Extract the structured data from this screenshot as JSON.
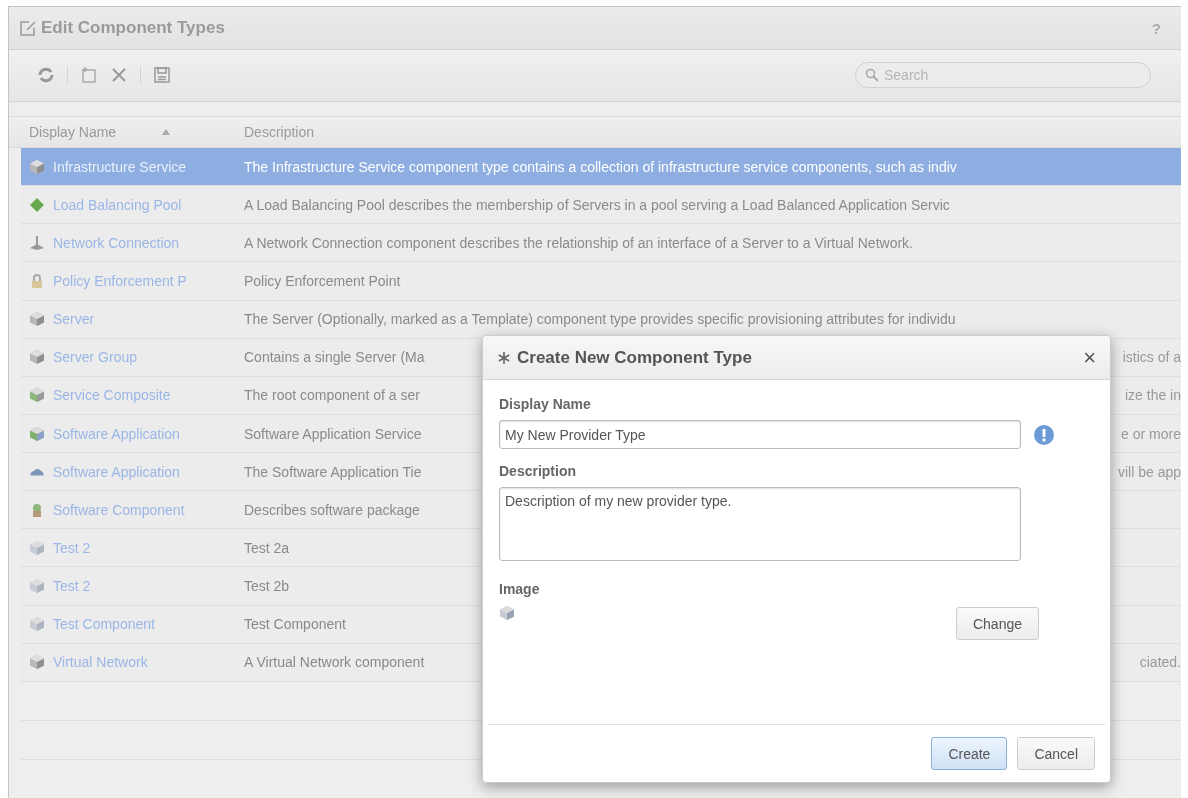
{
  "window": {
    "title": "Edit Component Types",
    "help": "?"
  },
  "toolbar": {
    "search": {
      "placeholder": "Search"
    }
  },
  "table": {
    "columns": [
      {
        "label": "Display Name",
        "sorted": true
      },
      {
        "label": "Description",
        "sorted": false
      }
    ],
    "rows": [
      {
        "name": "Infrastructure Service",
        "description": "The Infrastructure Service component type contains a collection of infrastructure service components, such as indiv",
        "selected": true
      },
      {
        "name": "Load Balancing Pool",
        "description": "A Load Balancing Pool describes the membership of Servers in a pool serving a Load Balanced Application Servic",
        "selected": false
      },
      {
        "name": "Network Connection",
        "description": "A Network Connection component describes the relationship of an interface of a Server to a Virtual Network.",
        "selected": false
      },
      {
        "name": "Policy Enforcement P",
        "description": "Policy Enforcement Point",
        "selected": false
      },
      {
        "name": "Server",
        "description": "The Server (Optionally, marked as a Template) component type provides specific provisioning attributes for individu",
        "selected": false
      },
      {
        "name": "Server Group",
        "description": "Contains a single Server (Ma",
        "tail": "istics of a",
        "selected": false
      },
      {
        "name": "Service Composite",
        "description": "The root component of a ser",
        "tail": "ize the in",
        "selected": false
      },
      {
        "name": "Software Application",
        "description": "Software Application Service",
        "tail": "e or more",
        "selected": false
      },
      {
        "name": "Software Application",
        "description": "The Software Application Tie",
        "tail": "vill be app",
        "selected": false
      },
      {
        "name": "Software Component",
        "description": "Describes software package",
        "selected": false
      },
      {
        "name": "Test 2",
        "description": "Test 2a",
        "selected": false
      },
      {
        "name": "Test 2",
        "description": "Test 2b",
        "selected": false
      },
      {
        "name": "Test Component",
        "description": "Test Component",
        "selected": false
      },
      {
        "name": "Virtual Network",
        "description": "A Virtual Network component",
        "tail": "ciated.",
        "selected": false
      }
    ]
  },
  "dialog": {
    "title": "Create New Component Type",
    "close": "×",
    "display_name": {
      "label": "Display Name",
      "value": "My New Provider Type",
      "warning": true
    },
    "description": {
      "label": "Description",
      "value": "Description of my new provider type."
    },
    "image": {
      "label": "Image",
      "button": "Change"
    },
    "buttons": [
      {
        "label": "Create",
        "primary": true
      },
      {
        "label": "Cancel",
        "primary": false
      }
    ]
  }
}
